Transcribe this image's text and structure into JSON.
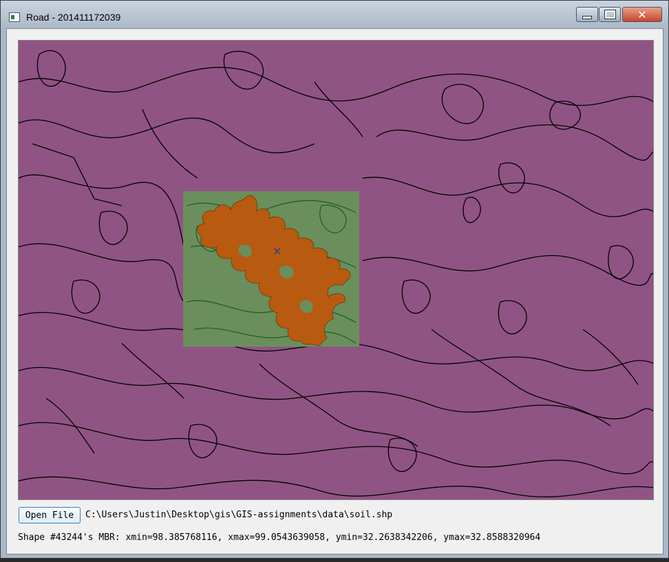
{
  "window": {
    "title": "Road - 201411172039",
    "close_glyph": "✕"
  },
  "map": {
    "background_color": "#8f5483",
    "selection_color": "#6a8f5c",
    "shape_color": "#b85a10",
    "outline_color": "#000000",
    "center_marker_glyph": "×"
  },
  "controls": {
    "open_file_label": "Open File",
    "file_path": "C:\\Users\\Justin\\Desktop\\gis\\GIS-assignments\\data\\soil.shp"
  },
  "status": {
    "mbr_text": "Shape #43244's MBR: xmin=98.385768116, xmax=99.0543639058, ymin=32.2638342206, ymax=32.8588320964"
  }
}
